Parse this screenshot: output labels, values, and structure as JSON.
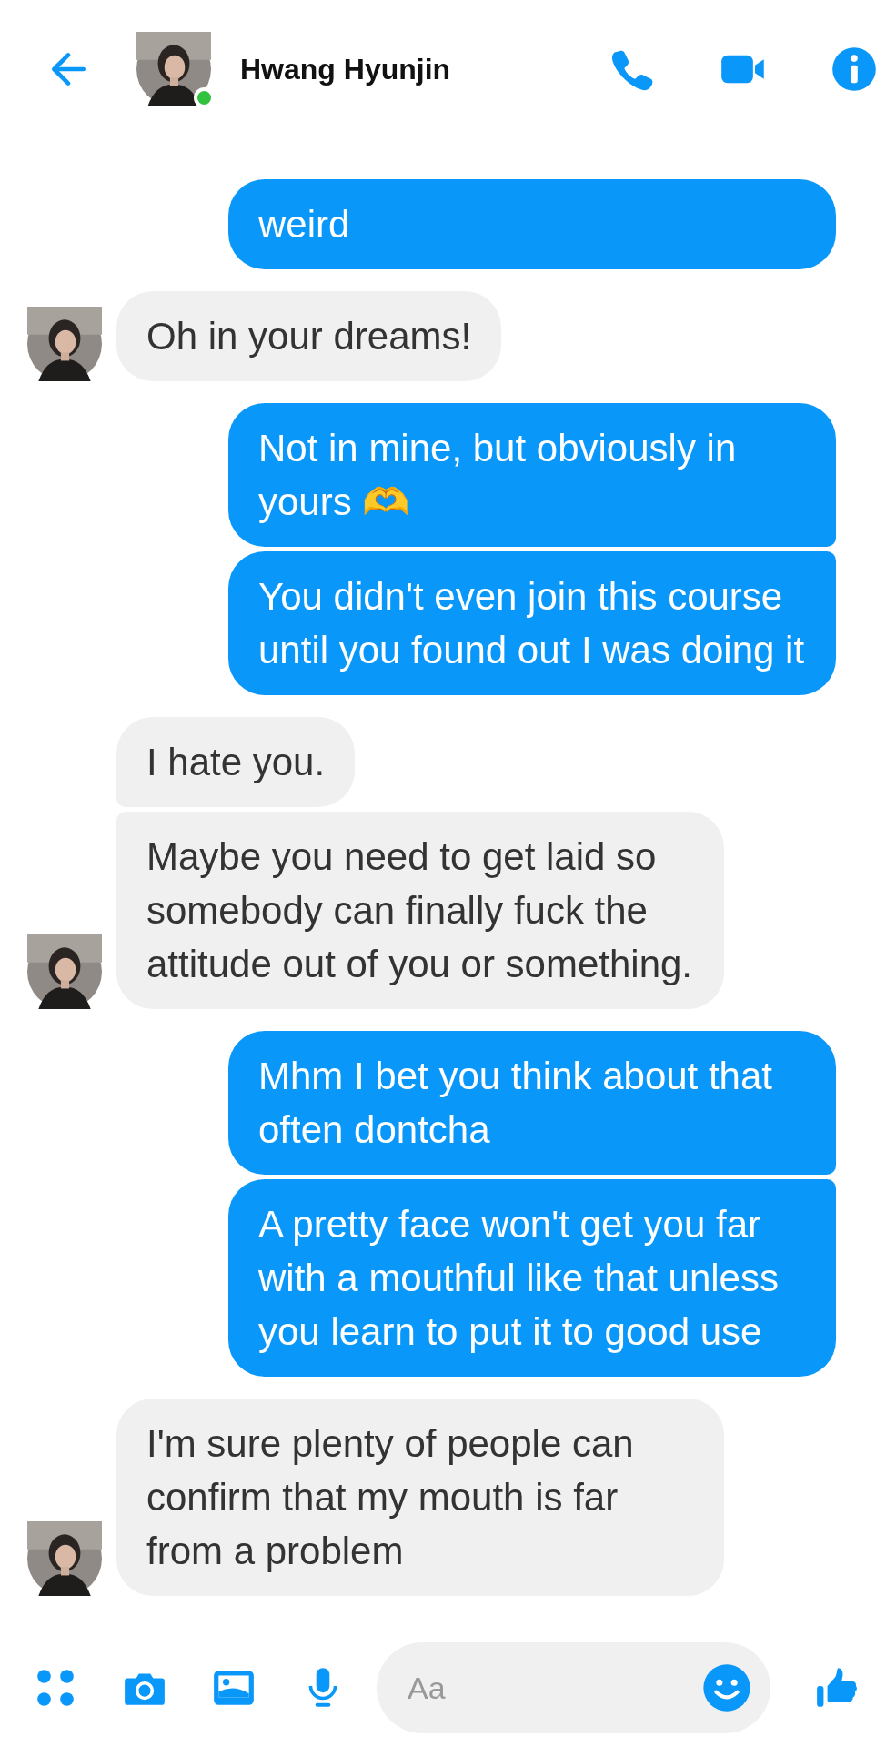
{
  "header": {
    "contact_name": "Hwang Hyunjin",
    "online": true
  },
  "groups": [
    {
      "kind": "sent",
      "messages": [
        "weird"
      ]
    },
    {
      "kind": "received",
      "messages": [
        "Oh in your dreams!"
      ]
    },
    {
      "kind": "sent",
      "messages": [
        "Not in mine, but obviously in yours 🫶",
        "You didn't even join this course until you found out I was doing it"
      ]
    },
    {
      "kind": "received",
      "messages": [
        "I hate you.",
        "Maybe you need to get laid so somebody can finally fuck the attitude out of you or something."
      ]
    },
    {
      "kind": "sent",
      "messages": [
        "Mhm I bet you think about that often dontcha",
        "A pretty face won't get you far with a mouthful like that unless you learn to put it to good use"
      ]
    },
    {
      "kind": "received",
      "messages": [
        "I'm sure plenty of people can confirm that my mouth is far from a problem"
      ]
    }
  ],
  "composer": {
    "placeholder": "Aa"
  }
}
